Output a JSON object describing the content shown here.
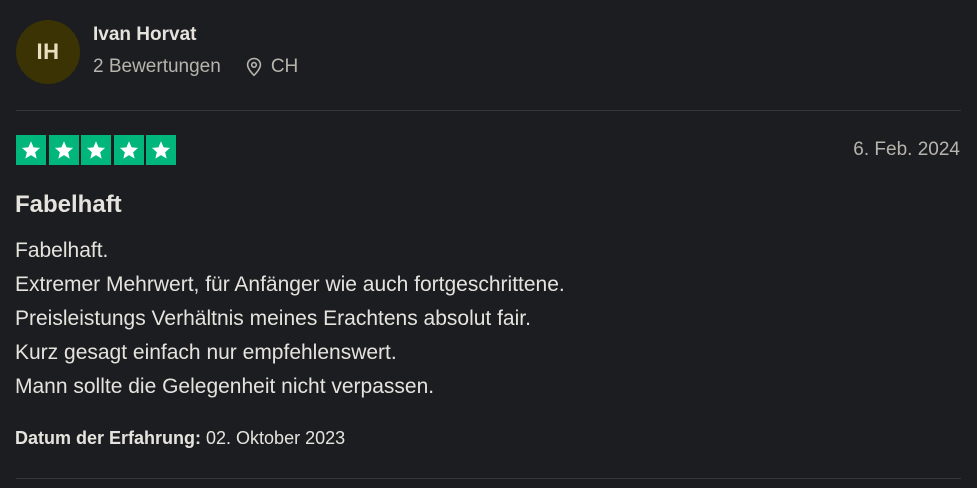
{
  "reviewer": {
    "initials": "IH",
    "name": "Ivan Horvat",
    "review_count": "2 Bewertungen",
    "country": "CH",
    "avatar_color": "#3b3304"
  },
  "review": {
    "rating": 5,
    "max_rating": 5,
    "star_color": "#00b67a",
    "date": "6. Feb. 2024",
    "title": "Fabelhaft",
    "body_lines": [
      "Fabelhaft.",
      "Extremer Mehrwert, für Anfänger wie auch fortgeschrittene.",
      "Preisleistungs Verhältnis meines Erachtens absolut fair.",
      "Kurz gesagt einfach nur empfehlenswert.",
      "Mann sollte die Gelegenheit nicht verpassen."
    ],
    "experience_label": "Datum der Erfahrung:",
    "experience_date": "02. Oktober 2023"
  },
  "icons": {
    "location": "location-pin-icon",
    "star": "star-icon"
  }
}
